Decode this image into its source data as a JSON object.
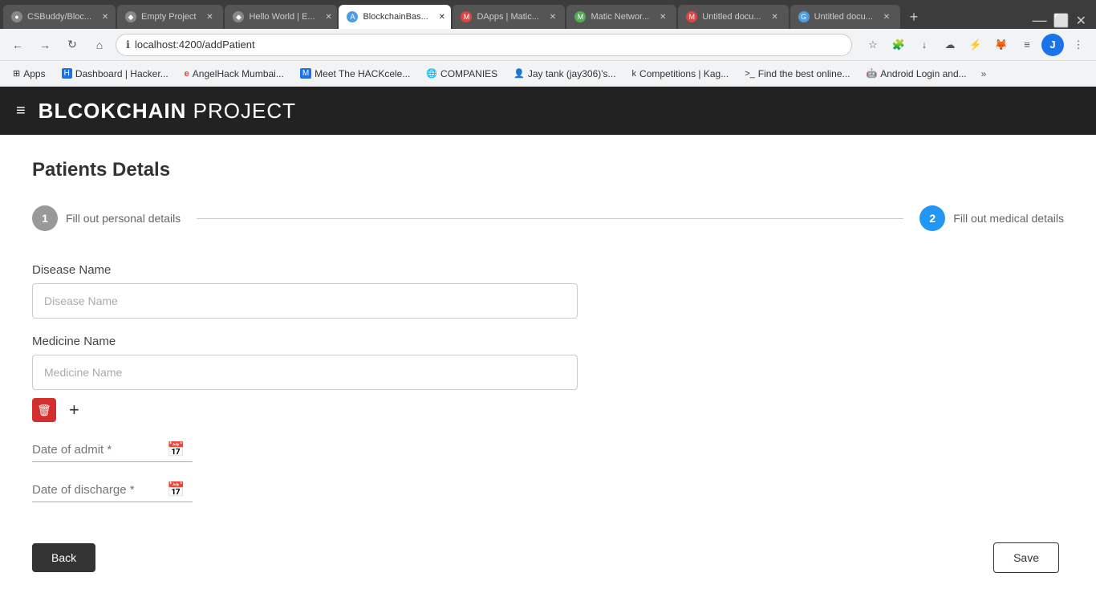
{
  "browser": {
    "tabs": [
      {
        "id": "tab-csbuddy",
        "label": "CSBuddy/Bloc...",
        "active": false,
        "icon_color": "#888",
        "icon_text": ""
      },
      {
        "id": "tab-empty",
        "label": "Empty Project",
        "active": false,
        "icon_color": "#888",
        "icon_text": ""
      },
      {
        "id": "tab-helloworld",
        "label": "Hello World | E...",
        "active": false,
        "icon_color": "#888",
        "icon_text": ""
      },
      {
        "id": "tab-blockchain",
        "label": "BlockchainBas...",
        "active": true,
        "icon_color": "#4e9de0",
        "icon_text": "A"
      },
      {
        "id": "tab-dapps",
        "label": "DApps | Matic...",
        "active": false,
        "icon_color": "#d44",
        "icon_text": "M"
      },
      {
        "id": "tab-matic",
        "label": "Matic Networ...",
        "active": false,
        "icon_color": "#5a5",
        "icon_text": "M"
      },
      {
        "id": "tab-gmail1",
        "label": "Untitled docu...",
        "active": false,
        "icon_color": "#d44",
        "icon_text": "M"
      },
      {
        "id": "tab-gdoc",
        "label": "Untitled docu...",
        "active": false,
        "icon_color": "#4e9de0",
        "icon_text": ""
      }
    ],
    "address": "localhost:4200/addPatient",
    "bookmarks": [
      {
        "id": "bm-apps",
        "label": "Apps",
        "icon": "⊞"
      },
      {
        "id": "bm-dashboard",
        "label": "Dashboard | Hacker...",
        "icon": "H"
      },
      {
        "id": "bm-angelhack",
        "label": "AngelHack Mumbai...",
        "icon": "e"
      },
      {
        "id": "bm-meet",
        "label": "Meet The HACKcele...",
        "icon": "M"
      },
      {
        "id": "bm-companies",
        "label": "COMPANIES",
        "icon": ""
      },
      {
        "id": "bm-jay",
        "label": "Jay tank (jay306)'s...",
        "icon": ""
      },
      {
        "id": "bm-competitions",
        "label": "Competitions | Kag...",
        "icon": "k"
      },
      {
        "id": "bm-find",
        "label": "Find the best online...",
        "icon": ">"
      },
      {
        "id": "bm-android",
        "label": "Android Login and...",
        "icon": ""
      }
    ],
    "more_label": "»"
  },
  "app": {
    "header": {
      "title_bold": "BLCOKCHAIN",
      "title_light": " PROJECT",
      "hamburger": "≡"
    },
    "page": {
      "title": "Patients Detals"
    },
    "stepper": {
      "step1": {
        "number": "1",
        "label": "Fill out personal details",
        "state": "inactive"
      },
      "step2": {
        "number": "2",
        "label": "Fill out medical details",
        "state": "active"
      }
    },
    "form": {
      "disease_label": "Disease Name",
      "disease_placeholder": "Disease Name",
      "medicine_label": "Medicine Name",
      "medicine_placeholder": "Medicine Name",
      "date_admit_label": "Date of admit *",
      "date_discharge_label": "Date of discharge *",
      "delete_icon": "🗑",
      "add_icon": "+",
      "calendar_icon": "📅"
    },
    "buttons": {
      "back_label": "Back",
      "save_label": "Save"
    }
  }
}
